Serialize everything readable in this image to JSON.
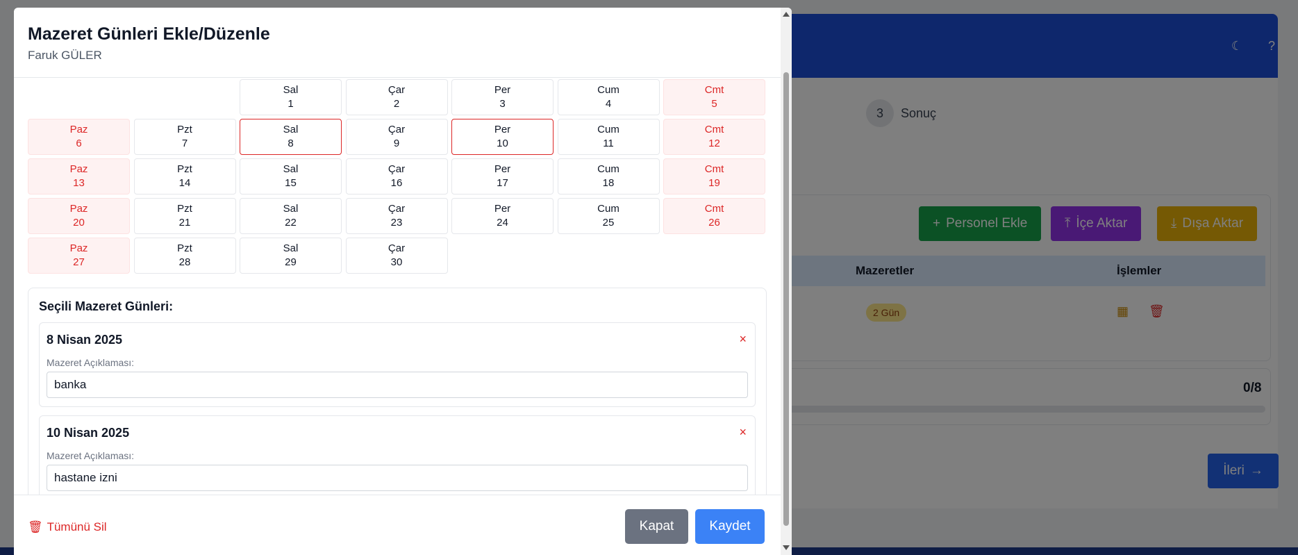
{
  "background": {
    "step": {
      "number": "3",
      "label": "Sonuç"
    },
    "buttons": {
      "add_staff": "Personel Ekle",
      "import": "İçe Aktar",
      "export": "Dışa Aktar"
    },
    "table": {
      "col_excuses": "Mazeretler",
      "col_actions": "İşlemler",
      "badge": "2 Gün"
    },
    "progress": "0/8",
    "next": "İleri"
  },
  "modal": {
    "title": "Mazeret Günleri Ekle/Düzenle",
    "subtitle": "Faruk GÜLER",
    "calendar": [
      {
        "name": "",
        "num": "",
        "empty": true
      },
      {
        "name": "",
        "num": "",
        "empty": true
      },
      {
        "name": "Sal",
        "num": "1"
      },
      {
        "name": "Çar",
        "num": "2"
      },
      {
        "name": "Per",
        "num": "3"
      },
      {
        "name": "Cum",
        "num": "4"
      },
      {
        "name": "Cmt",
        "num": "5",
        "weekend": true
      },
      {
        "name": "Paz",
        "num": "6",
        "weekend": true
      },
      {
        "name": "Pzt",
        "num": "7"
      },
      {
        "name": "Sal",
        "num": "8",
        "selected": true
      },
      {
        "name": "Çar",
        "num": "9"
      },
      {
        "name": "Per",
        "num": "10",
        "selected": true
      },
      {
        "name": "Cum",
        "num": "11"
      },
      {
        "name": "Cmt",
        "num": "12",
        "weekend": true
      },
      {
        "name": "Paz",
        "num": "13",
        "weekend": true
      },
      {
        "name": "Pzt",
        "num": "14"
      },
      {
        "name": "Sal",
        "num": "15"
      },
      {
        "name": "Çar",
        "num": "16"
      },
      {
        "name": "Per",
        "num": "17"
      },
      {
        "name": "Cum",
        "num": "18"
      },
      {
        "name": "Cmt",
        "num": "19",
        "weekend": true
      },
      {
        "name": "Paz",
        "num": "20",
        "weekend": true
      },
      {
        "name": "Pzt",
        "num": "21"
      },
      {
        "name": "Sal",
        "num": "22"
      },
      {
        "name": "Çar",
        "num": "23"
      },
      {
        "name": "Per",
        "num": "24"
      },
      {
        "name": "Cum",
        "num": "25"
      },
      {
        "name": "Cmt",
        "num": "26",
        "weekend": true
      },
      {
        "name": "Paz",
        "num": "27",
        "weekend": true
      },
      {
        "name": "Pzt",
        "num": "28"
      },
      {
        "name": "Sal",
        "num": "29"
      },
      {
        "name": "Çar",
        "num": "30"
      }
    ],
    "selected_title": "Seçili Mazeret Günleri:",
    "entries": [
      {
        "date": "8 Nisan 2025",
        "label": "Mazeret Açıklaması:",
        "value": "banka"
      },
      {
        "date": "10 Nisan 2025",
        "label": "Mazeret Açıklaması:",
        "value": "hastane izni"
      }
    ],
    "remove_symbol": "×",
    "footer": {
      "delete_all": "Tümünü Sil",
      "close": "Kapat",
      "save": "Kaydet"
    }
  }
}
